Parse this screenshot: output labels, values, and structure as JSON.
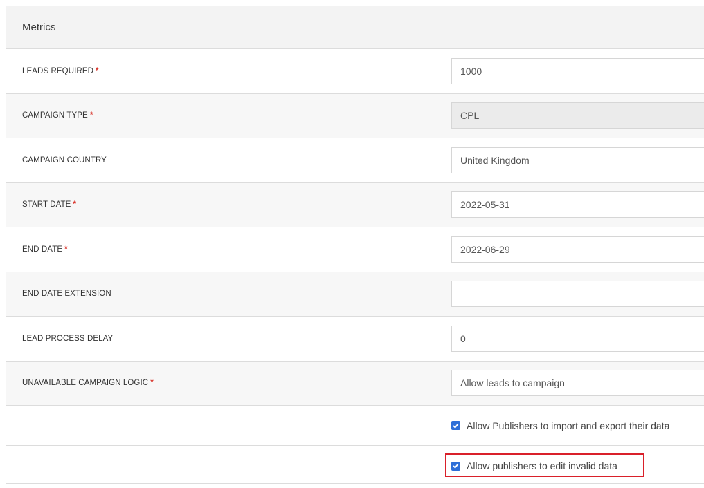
{
  "panel": {
    "title": "Metrics"
  },
  "rows": [
    {
      "label": "LEADS REQUIRED",
      "required": "*",
      "value": "1000"
    },
    {
      "label": "CAMPAIGN TYPE",
      "required": "*",
      "value": "CPL"
    },
    {
      "label": "CAMPAIGN COUNTRY",
      "value": "United Kingdom"
    },
    {
      "label": "START DATE",
      "required": "*",
      "value": "2022-05-31"
    },
    {
      "label": "END DATE",
      "required": "*",
      "value": "2022-06-29"
    },
    {
      "label": "END DATE EXTENSION",
      "value": ""
    },
    {
      "label": "LEAD PROCESS DELAY",
      "value": "0"
    },
    {
      "label": "UNAVAILABLE CAMPAIGN LOGIC",
      "required": "*",
      "value": "Allow leads to campaign"
    }
  ],
  "checkboxes": [
    {
      "label": "Allow Publishers to import and export their data",
      "checked": true
    },
    {
      "label": "Allow publishers to edit invalid data",
      "checked": true
    }
  ],
  "colors": {
    "accent": "#2e6fd8",
    "required": "#d9342b",
    "highlight": "#d9202a"
  }
}
